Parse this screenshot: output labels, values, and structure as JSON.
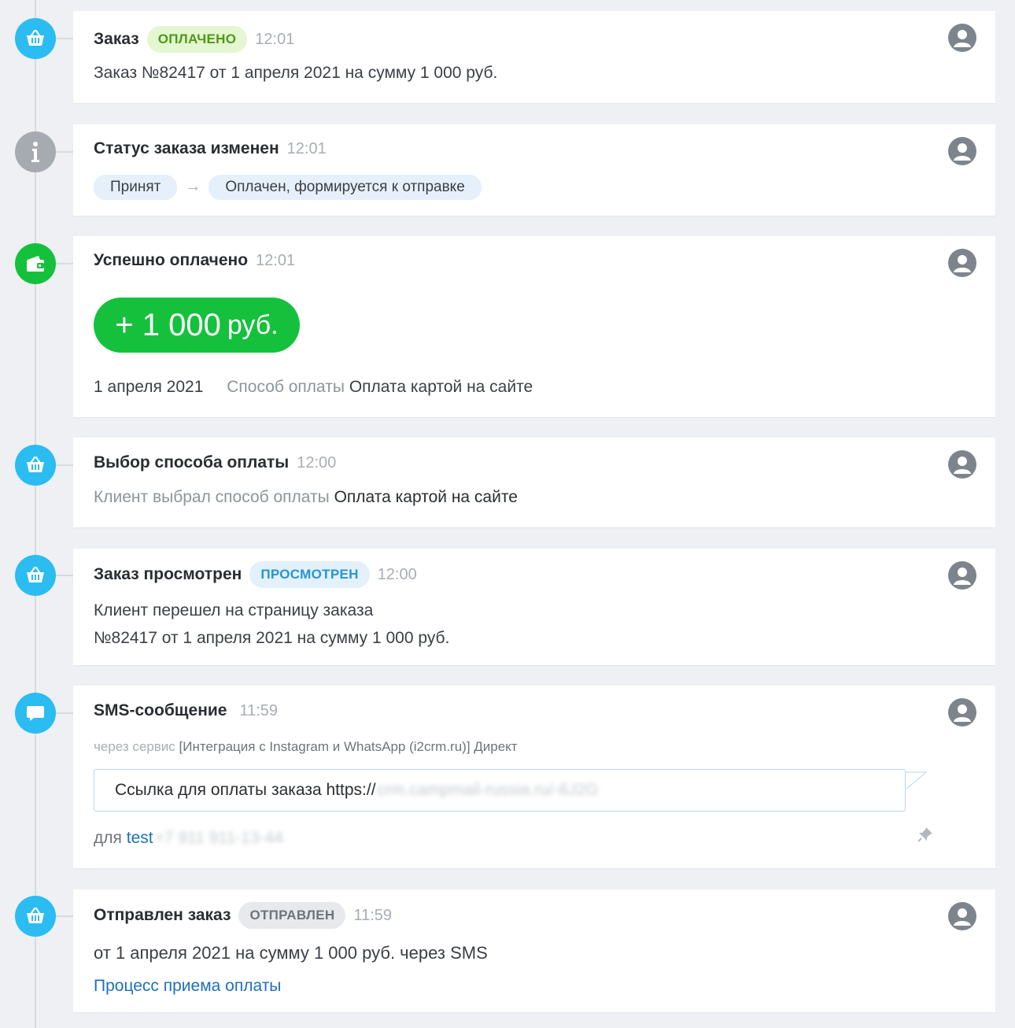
{
  "events": [
    {
      "title": "Заказ",
      "badge": "ОПЛАЧЕНО",
      "time": "12:01",
      "text": "Заказ №82417 от 1 апреля 2021 на сумму 1 000 руб."
    },
    {
      "title": "Статус заказа изменен",
      "time": "12:01",
      "from_status": "Принят",
      "to_status": "Оплачен, формируется к отправке"
    },
    {
      "title": "Успешно оплачено",
      "time": "12:01",
      "amount": "+ 1 000",
      "currency": "руб.",
      "date": "1 апреля 2021",
      "method_label": "Способ оплаты",
      "method_value": "Оплата картой на сайте"
    },
    {
      "title": "Выбор способа оплаты",
      "time": "12:00",
      "label": "Клиент выбрал способ оплаты",
      "value": "Оплата картой на сайте"
    },
    {
      "title": "Заказ просмотрен",
      "badge": "ПРОСМОТРЕН",
      "time": "12:00",
      "line1": "Клиент перешел на страницу заказа",
      "line2": "№82417 от 1 апреля 2021 на сумму 1 000 руб."
    },
    {
      "title": "SMS-сообщение",
      "time": "11:59",
      "via_label": "через сервис",
      "via_value": "[Интеграция с Instagram и WhatsApp (i2crm.ru)] Директ",
      "message": "Ссылка для оплаты заказа https://",
      "message_hidden": "crm.campmail-russia.ru/-6J2G",
      "to_label": "для",
      "to_name": "test",
      "to_phone": "+7 911 911-13-44"
    },
    {
      "title": "Отправлен заказ",
      "badge": "ОТПРАВЛЕН",
      "time": "11:59",
      "text": "от 1 апреля 2021 на сумму 1 000 руб. через SMS",
      "link": "Процесс приема оплаты"
    }
  ],
  "icons": {
    "order": "basket-icon",
    "status": "info-icon",
    "payment": "wallet-icon",
    "sms": "chat-bubble-icon",
    "author": "user-avatar-icon",
    "pin": "pin-icon"
  },
  "colors": {
    "blue_marker": "#2bbcf2",
    "gray_marker": "#a6abb1",
    "green_marker": "#15c13c",
    "link": "#1e6fbf"
  }
}
